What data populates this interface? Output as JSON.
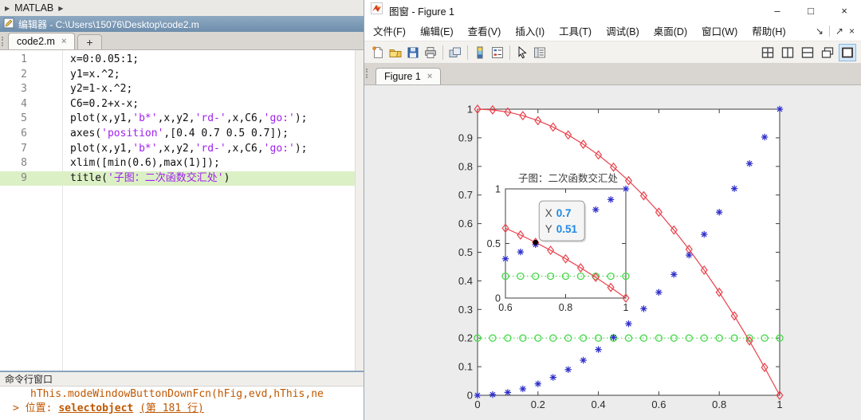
{
  "matlab_desktop": {
    "breadcrumb": "MATLAB",
    "editor": {
      "titlebar_text": "编辑器 - C:\\Users\\15076\\Desktop\\code2.m",
      "tab_label": "code2.m",
      "tab_close_glyph": "×",
      "new_tab_label": "+",
      "highlighted_line": 9,
      "code_lines": [
        {
          "num": "1",
          "segments": [
            {
              "t": "x=0:0.05:1;"
            }
          ]
        },
        {
          "num": "2",
          "segments": [
            {
              "t": "y1=x.^2;"
            }
          ]
        },
        {
          "num": "3",
          "segments": [
            {
              "t": "y2=1-x.^2;"
            }
          ]
        },
        {
          "num": "4",
          "segments": [
            {
              "t": "C6=0.2+x-x;"
            }
          ]
        },
        {
          "num": "5",
          "segments": [
            {
              "t": "plot(x,y1,"
            },
            {
              "t": "'b*'",
              "s": 1
            },
            {
              "t": ",x,y2,"
            },
            {
              "t": "'rd-'",
              "s": 1
            },
            {
              "t": ",x,C6,"
            },
            {
              "t": "'go:'",
              "s": 1
            },
            {
              "t": ");"
            }
          ]
        },
        {
          "num": "6",
          "segments": [
            {
              "t": "axes("
            },
            {
              "t": "'position'",
              "s": 1
            },
            {
              "t": ",[0.4 0.7 0.5 0.7]);"
            }
          ]
        },
        {
          "num": "7",
          "segments": [
            {
              "t": "plot(x,y1,"
            },
            {
              "t": "'b*'",
              "s": 1
            },
            {
              "t": ",x,y2,"
            },
            {
              "t": "'rd-'",
              "s": 1
            },
            {
              "t": ",x,C6,"
            },
            {
              "t": "'go:'",
              "s": 1
            },
            {
              "t": ");"
            }
          ]
        },
        {
          "num": "8",
          "segments": [
            {
              "t": "xlim([min(0.6),max(1)]);"
            }
          ]
        },
        {
          "num": "9",
          "segments": [
            {
              "t": "title("
            },
            {
              "t": "'子图：二次函数交汇处'",
              "s": 1
            },
            {
              "t": ")"
            }
          ]
        }
      ]
    },
    "command_window": {
      "title": "命令行窗口",
      "output_line": "hThis.modeWindowButtonDownFcn(hFig,evd,hThis,ne",
      "prompt": ">",
      "location_label": "位置:",
      "link_text": "selectobject",
      "line_ref": "(第 181 行)"
    }
  },
  "figure_window": {
    "title": "图窗 - Figure 1",
    "window_buttons": {
      "minimize": "–",
      "maximize": "□",
      "close": "×"
    },
    "menu_items": [
      "文件(F)",
      "编辑(E)",
      "查看(V)",
      "插入(I)",
      "工具(T)",
      "调试(B)",
      "桌面(D)",
      "窗口(W)",
      "帮助(H)"
    ],
    "menu_right_icons": [
      {
        "name": "dock-arrow-icon",
        "glyph": "↘"
      },
      {
        "name": "undock-arrow-icon",
        "glyph": "↗"
      },
      {
        "name": "menubar-close-icon",
        "glyph": "×"
      }
    ],
    "toolbar_left_icons": [
      "new-file-icon",
      "open-file-icon",
      "save-icon",
      "print-icon",
      "sep",
      "link-figure-icon",
      "sep",
      "colorbar-icon",
      "legend-icon",
      "sep",
      "edit-plot-cursor-icon",
      "property-editor-icon"
    ],
    "toolbar_right_icons": [
      "tile-grid-icon",
      "tile-columns-icon",
      "tile-rows-icon",
      "cascade-windows-icon",
      "single-window-icon"
    ],
    "toolbar_right_active": "single-window-icon",
    "tab_label": "Figure 1",
    "tab_close_glyph": "×"
  },
  "chart_data": {
    "type": "line",
    "x": [
      0,
      0.05,
      0.1,
      0.15,
      0.2,
      0.25,
      0.3,
      0.35,
      0.4,
      0.45,
      0.5,
      0.55,
      0.6,
      0.65,
      0.7,
      0.75,
      0.8,
      0.85,
      0.9,
      0.95,
      1
    ],
    "series": [
      {
        "name": "y1 = x.^2",
        "matlab_style": "b*",
        "color": "#2e2ecb",
        "marker": "asterisk",
        "line": "none",
        "values": [
          0,
          0.0025,
          0.01,
          0.0225,
          0.04,
          0.0625,
          0.09,
          0.1225,
          0.16,
          0.2025,
          0.25,
          0.3025,
          0.36,
          0.4225,
          0.49,
          0.5625,
          0.64,
          0.7225,
          0.81,
          0.9025,
          1
        ]
      },
      {
        "name": "y2 = 1-x.^2",
        "matlab_style": "rd-",
        "color": "#e8414b",
        "marker": "diamond",
        "line": "solid",
        "values": [
          1,
          0.9975,
          0.99,
          0.9775,
          0.96,
          0.9375,
          0.91,
          0.8775,
          0.84,
          0.7975,
          0.75,
          0.6975,
          0.64,
          0.5775,
          0.51,
          0.4375,
          0.36,
          0.2775,
          0.19,
          0.0975,
          0
        ]
      },
      {
        "name": "C6 = 0.2+x-x",
        "matlab_style": "go:",
        "color": "#47d84a",
        "marker": "circle",
        "line": "dotted",
        "values": [
          0.2,
          0.2,
          0.2,
          0.2,
          0.2,
          0.2,
          0.2,
          0.2,
          0.2,
          0.2,
          0.2,
          0.2,
          0.2,
          0.2,
          0.2,
          0.2,
          0.2,
          0.2,
          0.2,
          0.2,
          0.2
        ]
      }
    ],
    "charts": [
      {
        "id": "main-axes",
        "title": "",
        "xlim": [
          0,
          1
        ],
        "ylim": [
          0,
          1
        ],
        "grid": false,
        "xticks": [
          0,
          0.2,
          0.4,
          0.6,
          0.8,
          1
        ],
        "xtick_labels": [
          "0",
          "0.2",
          "0.4",
          "0.6",
          "0.8",
          "1"
        ],
        "yticks": [
          0,
          0.1,
          0.2,
          0.3,
          0.4,
          0.5,
          0.6,
          0.7,
          0.8,
          0.9,
          1
        ],
        "ytick_labels": [
          "0",
          "0.1",
          "0.2",
          "0.3",
          "0.4",
          "0.5",
          "0.6",
          "0.7",
          "0.8",
          "0.9",
          "1"
        ]
      },
      {
        "id": "inset-axes",
        "title": "子图：二次函数交汇处",
        "xlim": [
          0.6,
          1
        ],
        "ylim": [
          0,
          1
        ],
        "grid": false,
        "xticks": [
          0.6,
          0.8,
          1
        ],
        "xtick_labels": [
          "0.6",
          "0.8",
          "1"
        ],
        "yticks": [
          0,
          0.5,
          1
        ],
        "ytick_labels": [
          "0",
          "0.5",
          "1"
        ],
        "datatip": {
          "x": 0.7,
          "y": 0.51,
          "x_label": "X",
          "y_label": "Y",
          "x_value_text": "0.7",
          "y_value_text": "0.51",
          "value_color": "#1e88e5"
        }
      }
    ]
  }
}
